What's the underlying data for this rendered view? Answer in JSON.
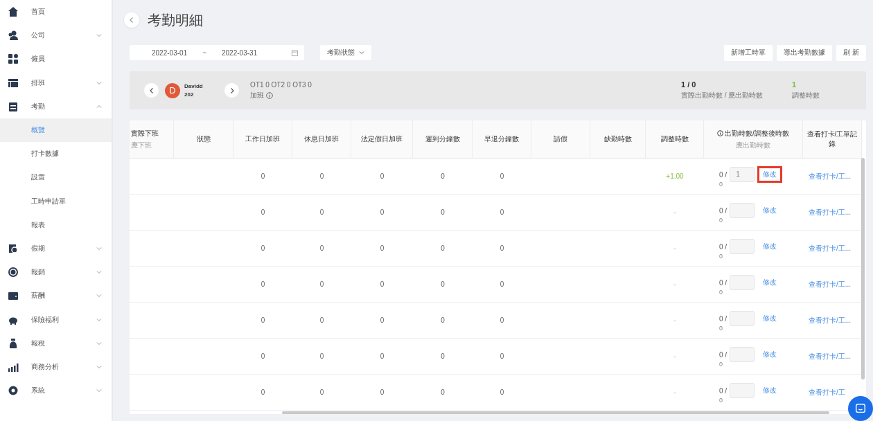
{
  "sidebar": {
    "items": [
      {
        "label": "首頁",
        "kind": "link",
        "selected": false
      },
      {
        "label": "公司",
        "kind": "group",
        "expanded": false,
        "selected": false
      },
      {
        "label": "僱員",
        "kind": "link",
        "selected": false
      },
      {
        "label": "排班",
        "kind": "group",
        "expanded": false,
        "selected": false
      },
      {
        "label": "考勤",
        "kind": "group",
        "expanded": true,
        "selected": false,
        "children": [
          {
            "label": "概覽",
            "selected": true
          },
          {
            "label": "打卡數據",
            "selected": false
          },
          {
            "label": "設置",
            "selected": false
          },
          {
            "label": "工時申請單",
            "selected": false
          },
          {
            "label": "報表",
            "selected": false
          }
        ]
      },
      {
        "label": "假期",
        "kind": "group",
        "expanded": false,
        "selected": false
      },
      {
        "label": "報銷",
        "kind": "group",
        "expanded": false,
        "selected": false
      },
      {
        "label": "薪酬",
        "kind": "group",
        "expanded": false,
        "selected": false
      },
      {
        "label": "保險福利",
        "kind": "group",
        "expanded": false,
        "selected": false
      },
      {
        "label": "報稅",
        "kind": "group",
        "expanded": false,
        "selected": false
      },
      {
        "label": "商務分析",
        "kind": "group",
        "expanded": false,
        "selected": false
      },
      {
        "label": "系統",
        "kind": "group",
        "expanded": false,
        "selected": false
      }
    ]
  },
  "page": {
    "title": "考勤明細"
  },
  "filters": {
    "date_from": "2022-03-01",
    "date_separator": "~",
    "date_to": "2022-03-31",
    "status_dropdown": "考勤狀態"
  },
  "actions": [
    "新增工時單",
    "導出考勤數據",
    "刷 新"
  ],
  "employee": {
    "avatar_letter": "D",
    "name": "Davidd",
    "number": "202",
    "overtime": "OT1 0 OT2 0 OT3 0",
    "overtime_label": "加班",
    "hours": "1 / 0",
    "hours_label": "實際出勤時數 / 應出勤時數",
    "adjusted": "1",
    "adjusted_label": "調整時數"
  },
  "table": {
    "columns": [
      {
        "label": "實際下班",
        "sub": "應下班"
      },
      {
        "label": "狀態"
      },
      {
        "label": "工作日加班"
      },
      {
        "label": "休息日加班"
      },
      {
        "label": "法定假日加班"
      },
      {
        "label": "遲到分鐘數"
      },
      {
        "label": "早退分鐘數"
      },
      {
        "label": "請假"
      },
      {
        "label": "缺勤時數"
      },
      {
        "label": "調整時數"
      },
      {
        "label": "出勤時數/調整後時數",
        "sub": "應出勤時數"
      },
      {
        "label": "查看打卡/工單記錄"
      }
    ],
    "rows": [
      {
        "workday_ot": "0",
        "rest_ot": "0",
        "holiday_ot": "0",
        "late": "0",
        "early": "0",
        "adjust": "+1.00",
        "adjust_positive": true,
        "attended": "0 /",
        "adjusted_value": "1",
        "expected": "0",
        "edit": "修改",
        "highlighted": true,
        "link": "查看打卡/工..."
      },
      {
        "workday_ot": "0",
        "rest_ot": "0",
        "holiday_ot": "0",
        "late": "0",
        "early": "0",
        "adjust": "-",
        "adjust_positive": false,
        "attended": "0 /",
        "expected": "0",
        "edit": "修改",
        "highlighted": false,
        "link": "查看打卡/工..."
      },
      {
        "workday_ot": "0",
        "rest_ot": "0",
        "holiday_ot": "0",
        "late": "0",
        "early": "0",
        "adjust": "-",
        "adjust_positive": false,
        "attended": "0 /",
        "expected": "0",
        "edit": "修改",
        "highlighted": false,
        "link": "查看打卡/工..."
      },
      {
        "workday_ot": "0",
        "rest_ot": "0",
        "holiday_ot": "0",
        "late": "0",
        "early": "0",
        "adjust": "-",
        "adjust_positive": false,
        "attended": "0 /",
        "expected": "0",
        "edit": "修改",
        "highlighted": false,
        "link": "查看打卡/工..."
      },
      {
        "workday_ot": "0",
        "rest_ot": "0",
        "holiday_ot": "0",
        "late": "0",
        "early": "0",
        "adjust": "-",
        "adjust_positive": false,
        "attended": "0 /",
        "expected": "0",
        "edit": "修改",
        "highlighted": false,
        "link": "查看打卡/工..."
      },
      {
        "workday_ot": "0",
        "rest_ot": "0",
        "holiday_ot": "0",
        "late": "0",
        "early": "0",
        "adjust": "-",
        "adjust_positive": false,
        "attended": "0 /",
        "expected": "0",
        "edit": "修改",
        "highlighted": false,
        "link": "查看打卡/工..."
      },
      {
        "workday_ot": "0",
        "rest_ot": "0",
        "holiday_ot": "0",
        "late": "0",
        "early": "0",
        "adjust": "-",
        "adjust_positive": false,
        "attended": "0 /",
        "expected": "0",
        "edit": "修改",
        "highlighted": false,
        "link": "查看打卡/工"
      }
    ]
  }
}
